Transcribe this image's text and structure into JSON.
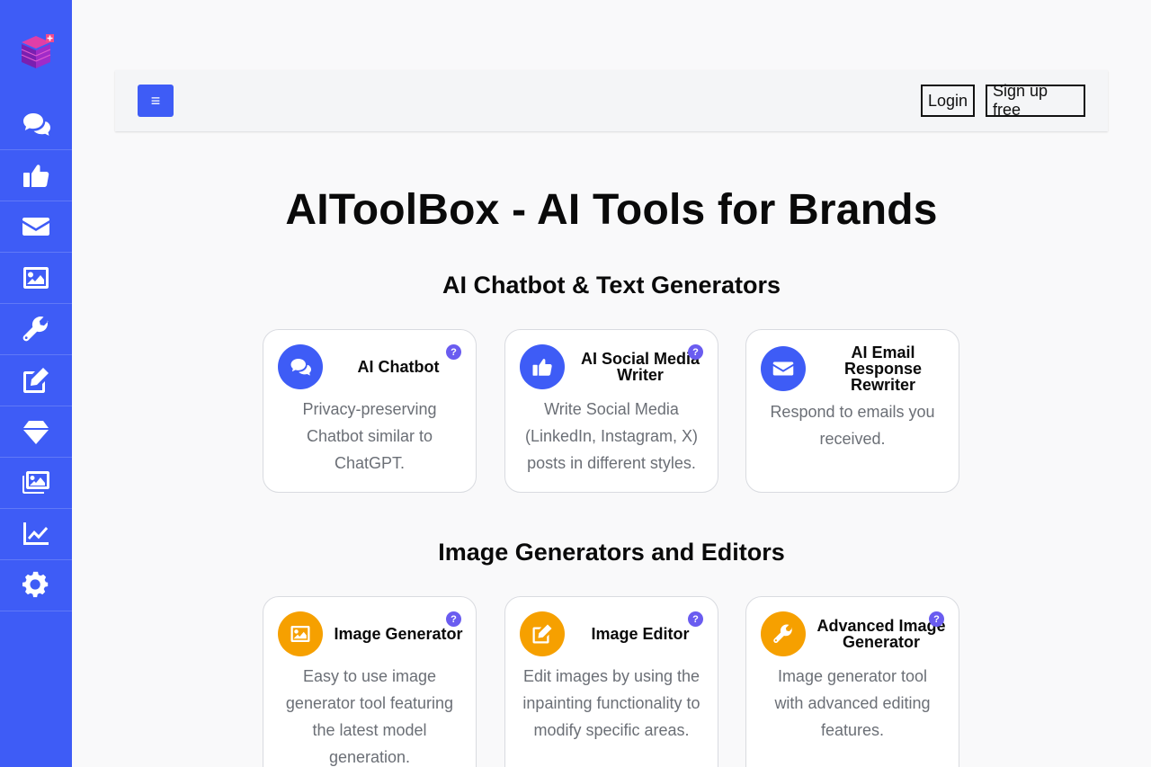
{
  "app": {
    "title": "AIToolBox - AI Tools for Brands"
  },
  "sidebar": {
    "logo_icon": "cube-stack-logo-icon",
    "items": [
      {
        "name": "chat",
        "icon": "comments-icon"
      },
      {
        "name": "social",
        "icon": "thumbs-up-icon"
      },
      {
        "name": "email",
        "icon": "envelope-icon"
      },
      {
        "name": "image",
        "icon": "image-icon"
      },
      {
        "name": "tools",
        "icon": "wrench-icon"
      },
      {
        "name": "edit",
        "icon": "edit-icon"
      },
      {
        "name": "premium",
        "icon": "gem-icon"
      },
      {
        "name": "gallery",
        "icon": "images-icon"
      },
      {
        "name": "analytics",
        "icon": "chart-line-icon"
      },
      {
        "name": "settings",
        "icon": "gear-icon"
      }
    ]
  },
  "topbar": {
    "menu_label": "≡",
    "login_label": "Login",
    "signup_label": "Sign up free"
  },
  "sections": [
    {
      "title": "AI Chatbot & Text Generators",
      "cards": [
        {
          "title": "AI Chatbot",
          "description": "Privacy-preserving Chatbot similar to ChatGPT.",
          "icon": "comments-icon",
          "help": "?"
        },
        {
          "title": "AI Social Media Writer",
          "description": "Write Social Media (LinkedIn, Instagram, X) posts in different styles.",
          "icon": "thumbs-up-icon",
          "help": "?"
        },
        {
          "title": "AI Email Response Rewriter",
          "description": "Respond to emails you received.",
          "icon": "envelope-icon",
          "help": ""
        }
      ]
    },
    {
      "title": "Image Generators and Editors",
      "cards": [
        {
          "title": "Image Generator",
          "description": "Easy to use image generator tool featuring the latest model generation.",
          "icon": "image-icon",
          "help": "?"
        },
        {
          "title": "Image Editor",
          "description": "Edit images by using the inpainting functionality to modify specific areas.",
          "icon": "edit-icon",
          "help": "?"
        },
        {
          "title": "Advanced Image Generator",
          "description": "Image generator tool with advanced editing features.",
          "icon": "wrench-icon",
          "help": "?"
        }
      ]
    }
  ],
  "colors": {
    "sidebar": "#3e5cf6",
    "accent_blue": "#3e5cf6",
    "accent_orange": "#f6a000",
    "help_badge": "#6a5cf0"
  }
}
